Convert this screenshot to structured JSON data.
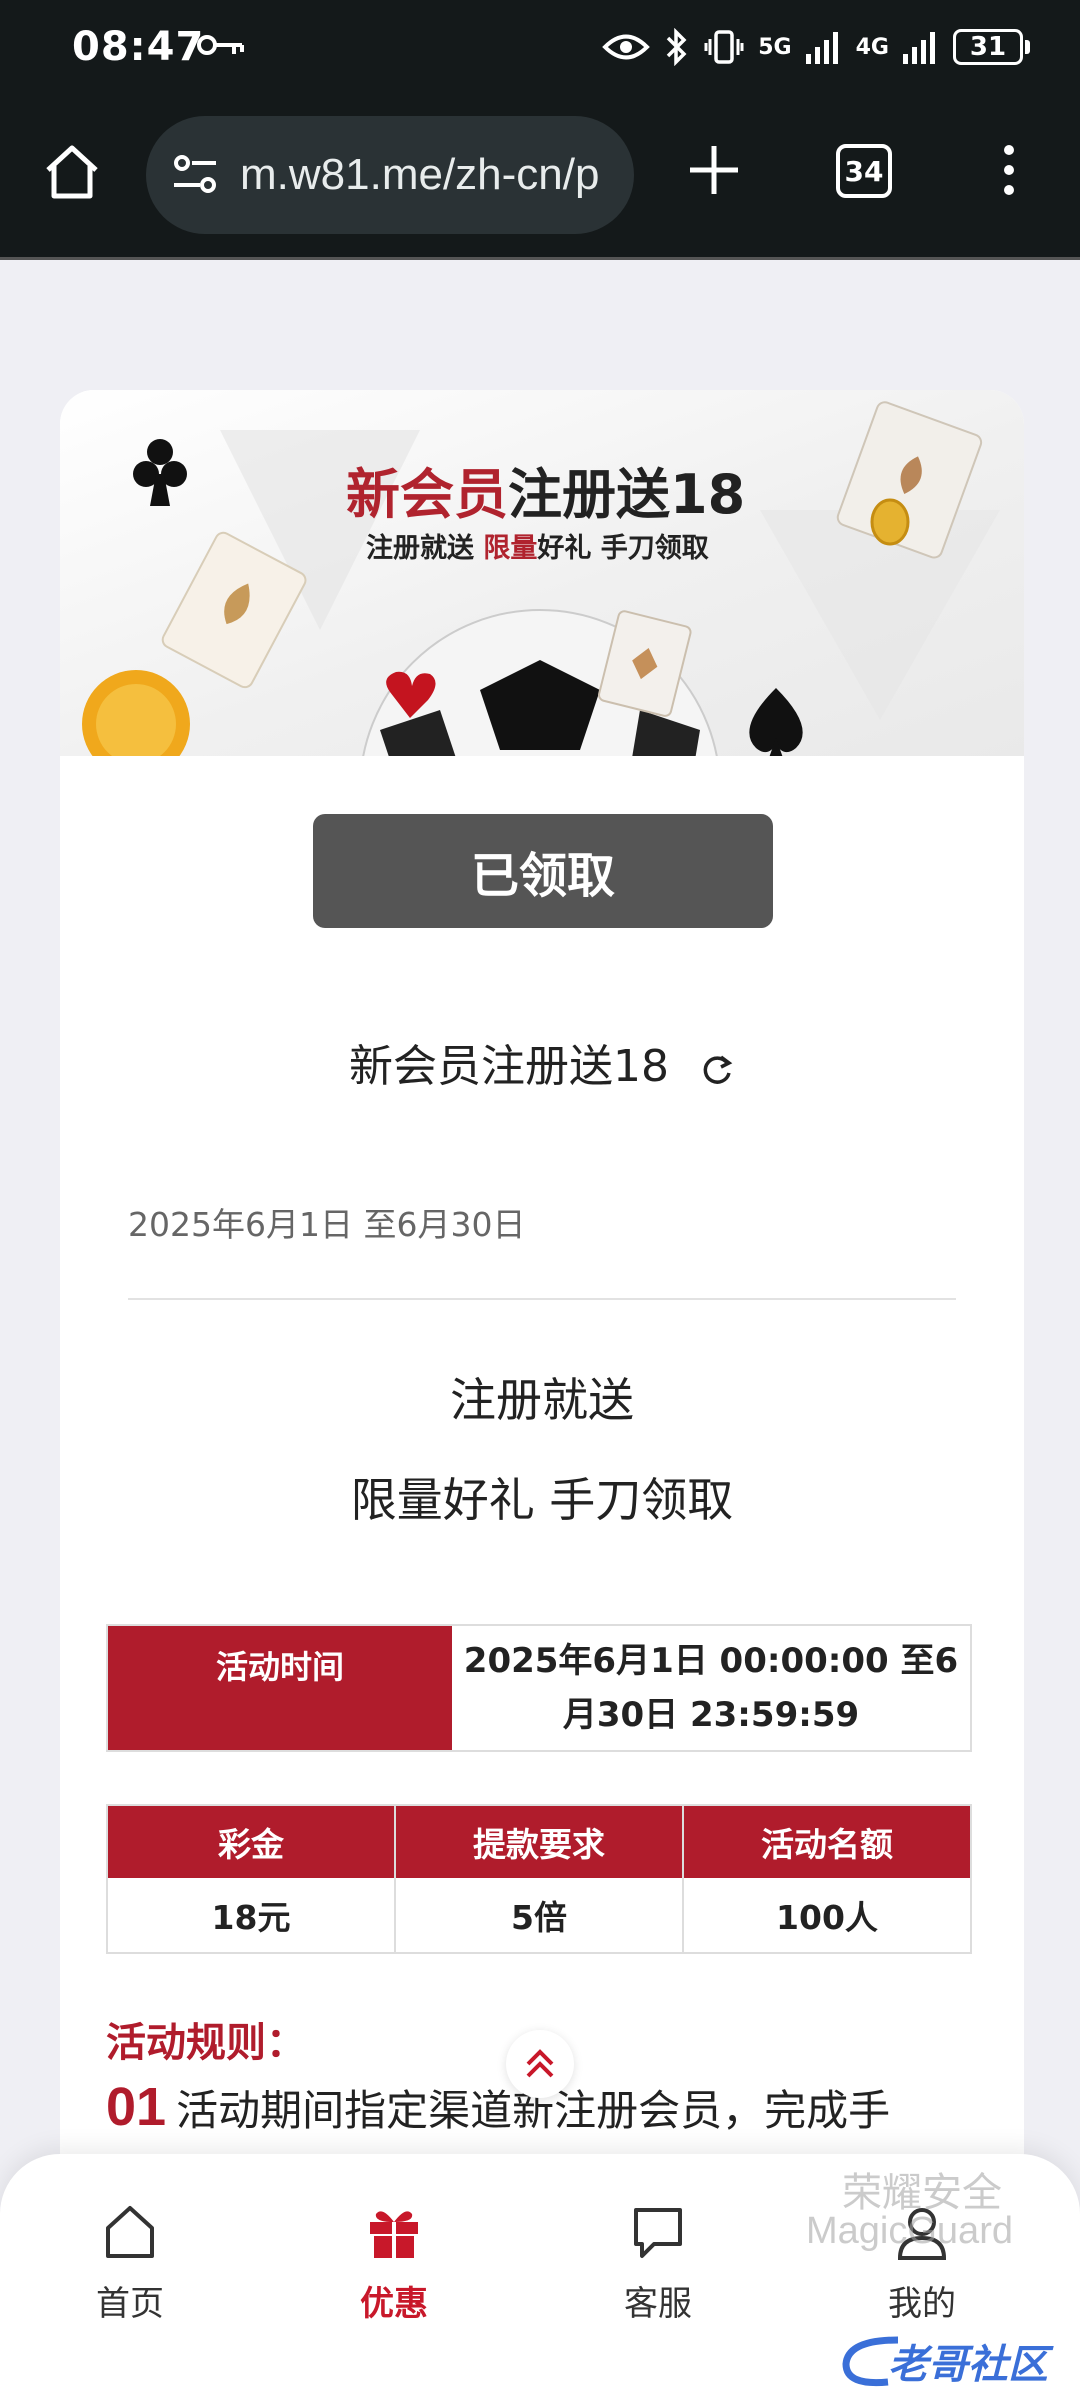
{
  "status_bar": {
    "time": "08:47",
    "network_1": "5G",
    "network_2": "4G",
    "battery": "31"
  },
  "browser": {
    "url": "m.w81.me/zh-cn/p",
    "tab_count": "34"
  },
  "banner": {
    "title_red": "新会员",
    "title_dark": "注册送18",
    "subtitle_part1": "注册就送 ",
    "subtitle_red": "限量",
    "subtitle_part2": "好礼 手刀领取"
  },
  "promo": {
    "button_label": "已领取",
    "name": "新会员注册送18",
    "date_range": "2025年6月1日 至6月30日",
    "desc_line1": "注册就送",
    "desc_line2": "限量好礼 手刀领取"
  },
  "time_table": {
    "header": "活动时间",
    "value": "2025年6月1日 00:00:00 至6月30日 23:59:59"
  },
  "bonus_table": {
    "headers": [
      "彩金",
      "提款要求",
      "活动名额"
    ],
    "values": [
      "18元",
      "5倍",
      "100人"
    ]
  },
  "rules": {
    "title": "活动规则：",
    "item1_num": "01",
    "item1_text": "活动期间指定渠道新注册会员，完成手"
  },
  "bottom_nav": {
    "items": [
      {
        "label": "首页"
      },
      {
        "label": "优惠"
      },
      {
        "label": "客服"
      },
      {
        "label": "我的"
      }
    ]
  },
  "overlay": {
    "watermark_line1": "荣耀安全",
    "watermark_line2": "MagicGuard",
    "brand_text": "老哥社区"
  },
  "colors": {
    "accent_red": "#b01c2c",
    "claimed_button": "#555555",
    "browser_chrome": "#14191a"
  }
}
